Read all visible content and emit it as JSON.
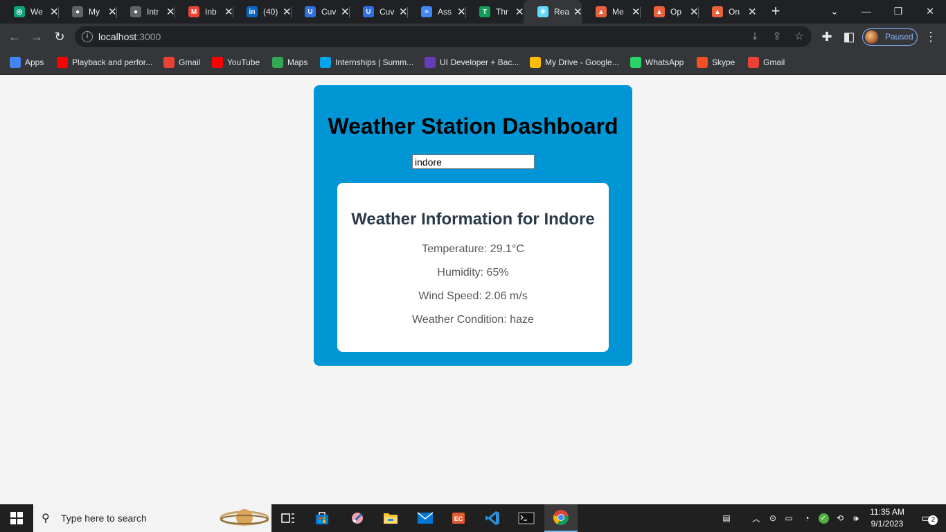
{
  "browser": {
    "tabs": [
      {
        "label": "We",
        "icon": "chatgpt-icon",
        "color": "#10a37f",
        "glyph": "◎"
      },
      {
        "label": "My",
        "icon": "globe-icon",
        "color": "#5f6368",
        "glyph": "●"
      },
      {
        "label": "Intr",
        "icon": "globe-icon",
        "color": "#5f6368",
        "glyph": "●"
      },
      {
        "label": "Inb",
        "icon": "gmail-icon",
        "color": "#ea4335",
        "glyph": "M"
      },
      {
        "label": "(40)",
        "icon": "linkedin-icon",
        "color": "#0a66c2",
        "glyph": "in"
      },
      {
        "label": "Cuv",
        "icon": "cuvette-icon",
        "color": "#2f6fdf",
        "glyph": "U"
      },
      {
        "label": "Cuv",
        "icon": "cuvette-icon",
        "color": "#2f6fdf",
        "glyph": "U"
      },
      {
        "label": "Ass",
        "icon": "google-docs-icon",
        "color": "#4285f4",
        "glyph": "≡"
      },
      {
        "label": "Thr",
        "icon": "threads-icon",
        "color": "#0f9d58",
        "glyph": "T"
      },
      {
        "label": "Rea",
        "icon": "react-icon",
        "color": "#61dafb",
        "glyph": "⚛"
      },
      {
        "label": "Me",
        "icon": "mushroom-icon",
        "color": "#e8603c",
        "glyph": "▲"
      },
      {
        "label": "Op",
        "icon": "mushroom-icon",
        "color": "#e8603c",
        "glyph": "▲"
      },
      {
        "label": "On",
        "icon": "mushroom-icon",
        "color": "#e8603c",
        "glyph": "▲"
      }
    ],
    "new_tab": "+",
    "address": {
      "host": "localhost",
      "port": ":3000"
    },
    "profile_status": "Paused",
    "bookmarks": [
      {
        "label": "Apps",
        "icon": "apps-grid-icon",
        "color": "#4285f4"
      },
      {
        "label": "Playback and perfor...",
        "icon": "youtube-icon",
        "color": "#ff0000"
      },
      {
        "label": "Gmail",
        "icon": "gmail-icon",
        "color": "#ea4335"
      },
      {
        "label": "YouTube",
        "icon": "youtube-icon",
        "color": "#ff0000"
      },
      {
        "label": "Maps",
        "icon": "maps-pin-icon",
        "color": "#34a853"
      },
      {
        "label": "Internships | Summ...",
        "icon": "internshala-icon",
        "color": "#00a5ec"
      },
      {
        "label": "UI Developer + Bac...",
        "icon": "forms-icon",
        "color": "#673ab7"
      },
      {
        "label": "My Drive - Google...",
        "icon": "google-drive-icon",
        "color": "#fbbc04"
      },
      {
        "label": "WhatsApp",
        "icon": "whatsapp-icon",
        "color": "#25d366"
      },
      {
        "label": "Skype",
        "icon": "microsoft-icon",
        "color": "#f25022"
      },
      {
        "label": "Gmail",
        "icon": "gmail-icon",
        "color": "#ea4335"
      }
    ]
  },
  "dashboard": {
    "title": "Weather Station Dashboard",
    "city_value": "indore",
    "info_title": "Weather Information for Indore",
    "lines": [
      "Temperature: 29.1°C",
      "Humidity: 65%",
      "Wind Speed: 2.06 m/s",
      "Weather Condition: haze"
    ],
    "accent": "#0096d6"
  },
  "taskbar": {
    "search_placeholder": "Type here to search",
    "clock_time": "11:35 AM",
    "clock_date": "9/1/2023",
    "notification_count": "2"
  }
}
